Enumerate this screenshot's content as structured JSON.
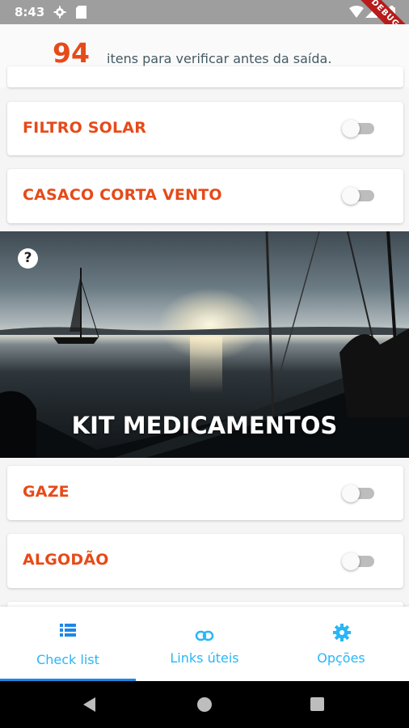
{
  "status_bar": {
    "time": "8:43",
    "icons": [
      "gear-icon",
      "sd-card-icon",
      "wifi-icon",
      "signal-icon",
      "battery-icon"
    ],
    "debug_label": "DEBUG"
  },
  "header": {
    "count": "94",
    "text": "itens para verificar antes da saída."
  },
  "items_top": [
    {
      "label": "FILTRO SOLAR",
      "checked": false
    },
    {
      "label": "CASACO CORTA VENTO",
      "checked": false
    }
  ],
  "section": {
    "title": "KIT MEDICAMENTOS",
    "help_icon": "help-icon",
    "help_glyph": "?"
  },
  "items_bottom": [
    {
      "label": "GAZE",
      "checked": false
    },
    {
      "label": "ALGODÃO",
      "checked": false
    }
  ],
  "bottom_nav": {
    "items": [
      {
        "label": "Check list",
        "icon": "list-icon",
        "active": true
      },
      {
        "label": "Links úteis",
        "icon": "link-icon",
        "active": false
      },
      {
        "label": "Opções",
        "icon": "gear-icon",
        "active": false
      }
    ]
  },
  "colors": {
    "accent": "#e64a19",
    "nav_active": "#29b6f6",
    "indicator": "#1e88e5",
    "text_secondary": "#455a64"
  }
}
